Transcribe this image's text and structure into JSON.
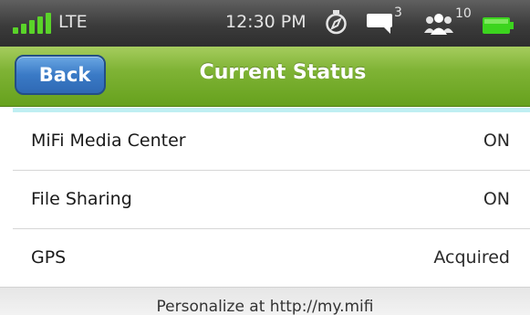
{
  "status_bar": {
    "network": "LTE",
    "time": "12:30 PM",
    "message_count": "3",
    "connected_users": "10",
    "signal_color": "#5ad329",
    "battery_color": "#3cd41e",
    "icons": [
      "signal-icon",
      "compass-icon",
      "message-icon",
      "people-icon",
      "battery-icon"
    ]
  },
  "header": {
    "back_label": "Back",
    "title": "Current Status",
    "accent_color": "#7fb335",
    "back_color": "#3a7ac6"
  },
  "rows": [
    {
      "label": "MiFi Media Center",
      "value": "ON"
    },
    {
      "label": "File Sharing",
      "value": "ON"
    },
    {
      "label": "GPS",
      "value": "Acquired"
    }
  ],
  "footer": {
    "text": "Personalize at http://my.mifi"
  }
}
